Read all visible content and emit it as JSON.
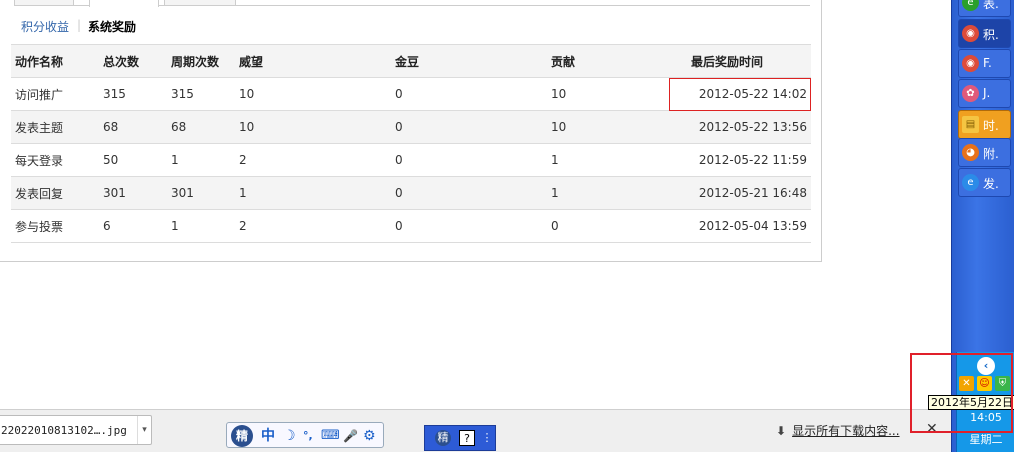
{
  "subtabs": {
    "points": "积分收益",
    "separator": "|",
    "rewards": "系统奖励"
  },
  "table": {
    "headers": [
      "动作名称",
      "总次数",
      "周期次数",
      "威望",
      "金豆",
      "贡献",
      "最后奖励时间"
    ],
    "rows": [
      [
        "访问推广",
        "315",
        "315",
        "10",
        "0",
        "10",
        "2012-05-22 14:02"
      ],
      [
        "发表主题",
        "68",
        "68",
        "10",
        "0",
        "10",
        "2012-05-22 13:56"
      ],
      [
        "每天登录",
        "50",
        "1",
        "2",
        "0",
        "1",
        "2012-05-22 11:59"
      ],
      [
        "发表回复",
        "301",
        "301",
        "1",
        "0",
        "1",
        "2012-05-21 16:48"
      ],
      [
        "参与投票",
        "6",
        "1",
        "2",
        "0",
        "0",
        "2012-05-04 13:59"
      ]
    ]
  },
  "download_bar": {
    "file_name": "22022010813102….jpg",
    "show_all": "显示所有下载内容..."
  },
  "taskbar": {
    "buttons": [
      {
        "label": "表.",
        "icon": "green-app-icon",
        "color": "#2aa02a"
      },
      {
        "label": "积.",
        "icon": "chrome-icon",
        "color": "#dd4b39"
      },
      {
        "label": "F.",
        "icon": "chrome-icon",
        "color": "#dd4b39"
      },
      {
        "label": "J.",
        "icon": "flower-icon",
        "color": "#e05a7a"
      },
      {
        "label": "时.",
        "icon": "folder-icon",
        "color": "#f5c542"
      },
      {
        "label": "附.",
        "icon": "firefox-icon",
        "color": "#e8711a"
      },
      {
        "label": "发.",
        "icon": "ie-icon",
        "color": "#2b8be8"
      }
    ],
    "tooltip": "2012年5月22日",
    "clock": "14:05",
    "weekday": "星期二"
  },
  "ime": {
    "logo": "精",
    "chars": [
      "中",
      "☽",
      "°,",
      "⌨",
      "🎤",
      "⚙"
    ]
  }
}
